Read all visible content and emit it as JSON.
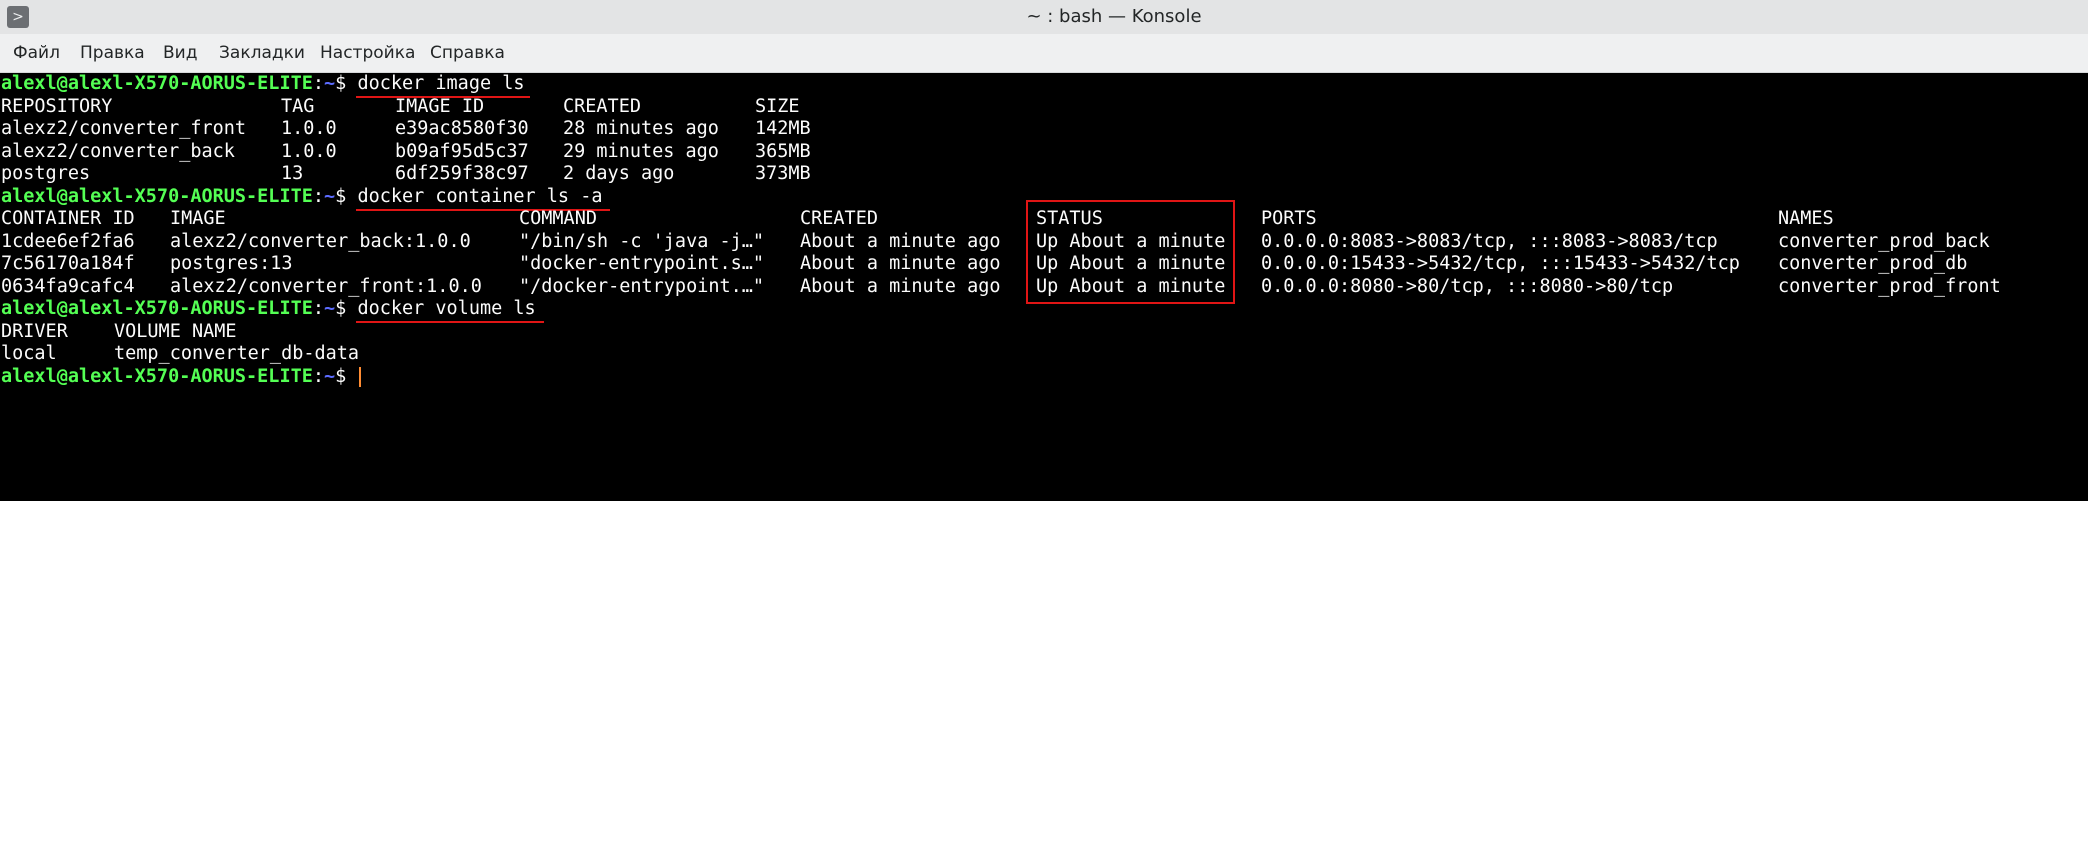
{
  "window": {
    "title": "~ : bash — Konsole",
    "app_icon": ">"
  },
  "menu": [
    "Файл",
    "Правка",
    "Вид",
    "Закладки",
    "Настройка",
    "Справка"
  ],
  "prompt": {
    "user_host": "alexl@alexl-X570-AORUS-ELITE",
    "sep": ":",
    "path": "~",
    "sign": "$"
  },
  "commands": {
    "c1": "docker image ls",
    "c2": "docker container ls -a",
    "c3": "docker volume ls"
  },
  "images": {
    "headers": [
      "REPOSITORY",
      "TAG",
      "IMAGE ID",
      "CREATED",
      "SIZE"
    ],
    "rows": [
      [
        "alexz2/converter_front",
        "1.0.0",
        "e39ac8580f30",
        "28 minutes ago",
        "142MB"
      ],
      [
        "alexz2/converter_back",
        "1.0.0",
        "b09af95d5c37",
        "29 minutes ago",
        "365MB"
      ],
      [
        "postgres",
        "13",
        "6df259f38c97",
        "2 days ago",
        "373MB"
      ]
    ]
  },
  "containers": {
    "headers": [
      "CONTAINER ID",
      "IMAGE",
      "COMMAND",
      "CREATED",
      "STATUS",
      "PORTS",
      "NAMES"
    ],
    "rows": [
      [
        "1cdee6ef2fa6",
        "alexz2/converter_back:1.0.0",
        "\"/bin/sh -c 'java -j…\"",
        "About a minute ago",
        "Up About a minute",
        "0.0.0.0:8083->8083/tcp, :::8083->8083/tcp",
        "converter_prod_back"
      ],
      [
        "7c56170a184f",
        "postgres:13",
        "\"docker-entrypoint.s…\"",
        "About a minute ago",
        "Up About a minute",
        "0.0.0.0:15433->5432/tcp, :::15433->5432/tcp",
        "converter_prod_db"
      ],
      [
        "0634fa9cafc4",
        "alexz2/converter_front:1.0.0",
        "\"/docker-entrypoint.…\"",
        "About a minute ago",
        "Up About a minute",
        "0.0.0.0:8080->80/tcp, :::8080->80/tcp",
        "converter_prod_front"
      ]
    ]
  },
  "volumes": {
    "headers": [
      "DRIVER",
      "VOLUME NAME"
    ],
    "rows": [
      [
        "local",
        "temp_converter_db-data"
      ]
    ]
  },
  "colors": {
    "prompt_user": "#54ff54",
    "prompt_path": "#5c6cff",
    "annotation": "#e01515",
    "cursor": "#ff8c33",
    "terminal_bg": "#000000",
    "terminal_fg": "#fcfcfc",
    "titlebar_bg": "#e3e4e5",
    "menubar_bg": "#eff0f1"
  },
  "icons": {
    "app": "terminal-icon"
  }
}
